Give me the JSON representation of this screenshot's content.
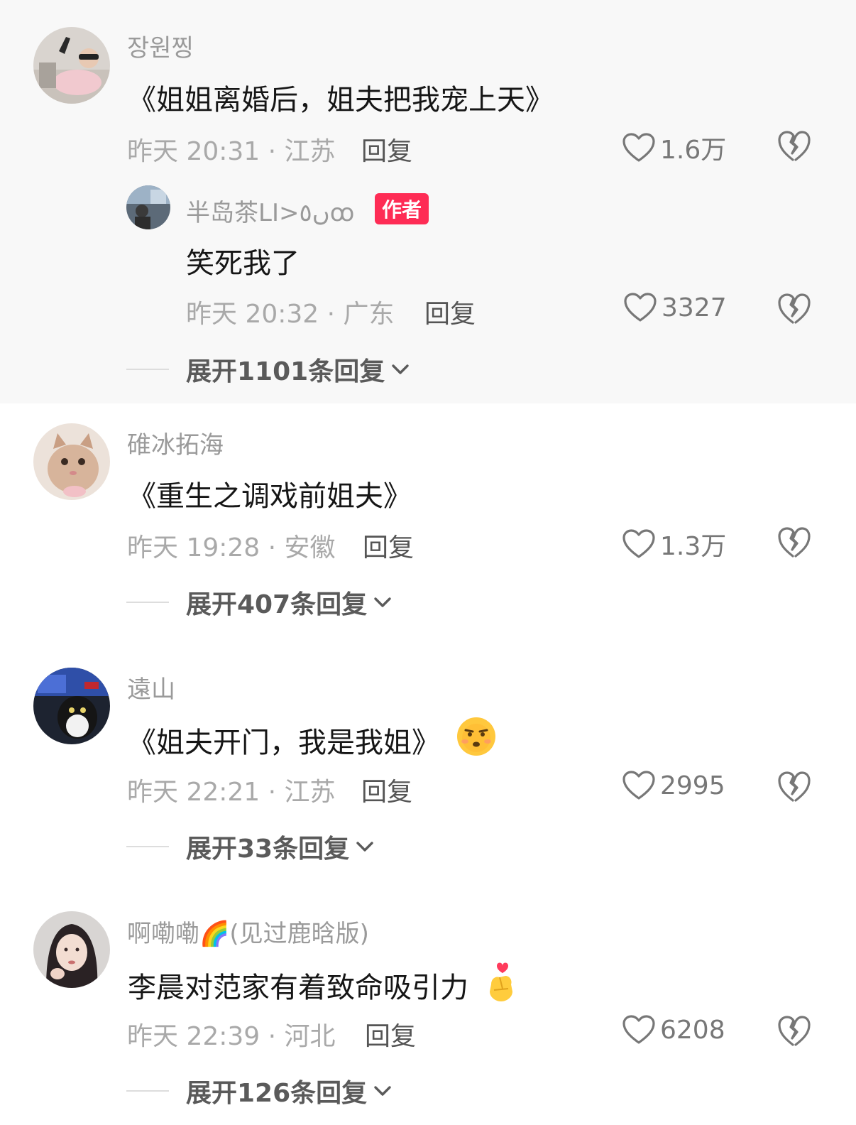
{
  "comments": [
    {
      "username": "장원찡",
      "text": "《姐姐离婚后，姐夫把我宠上天》",
      "meta": "昨天 20:31 · 江苏",
      "reply": "回复",
      "likes": "1.6万",
      "replies_toggle": "展开1101条回复",
      "sub_reply": {
        "username": "半岛茶LI>ں٥ꝏ",
        "badge": "作者",
        "text": "笑死我了",
        "meta": "昨天 20:32 · 广东",
        "reply": "回复",
        "likes": "3327"
      }
    },
    {
      "username": "碓冰拓海",
      "text": "《重生之调戏前姐夫》",
      "meta": "昨天 19:28 · 安徽",
      "reply": "回复",
      "likes": "1.3万",
      "replies_toggle": "展开407条回复"
    },
    {
      "username": "遠山",
      "text": "《姐夫开门，我是我姐》",
      "emoji": "smirk-face-emoji",
      "meta": "昨天 22:21 · 江苏",
      "reply": "回复",
      "likes": "2995",
      "replies_toggle": "展开33条回复"
    },
    {
      "username": "啊嘞嘞🌈(见过鹿晗版)",
      "text": "李晨对范家有着致命吸引力",
      "emoji": "finger-heart-emoji",
      "meta": "昨天 22:39 · 河北",
      "reply": "回复",
      "likes": "6208",
      "replies_toggle": "展开126条回复"
    }
  ],
  "colors": {
    "author_badge": "#fe2c55",
    "muted_text": "#a9a9a9",
    "highlight_band": "#f8f8f8"
  }
}
